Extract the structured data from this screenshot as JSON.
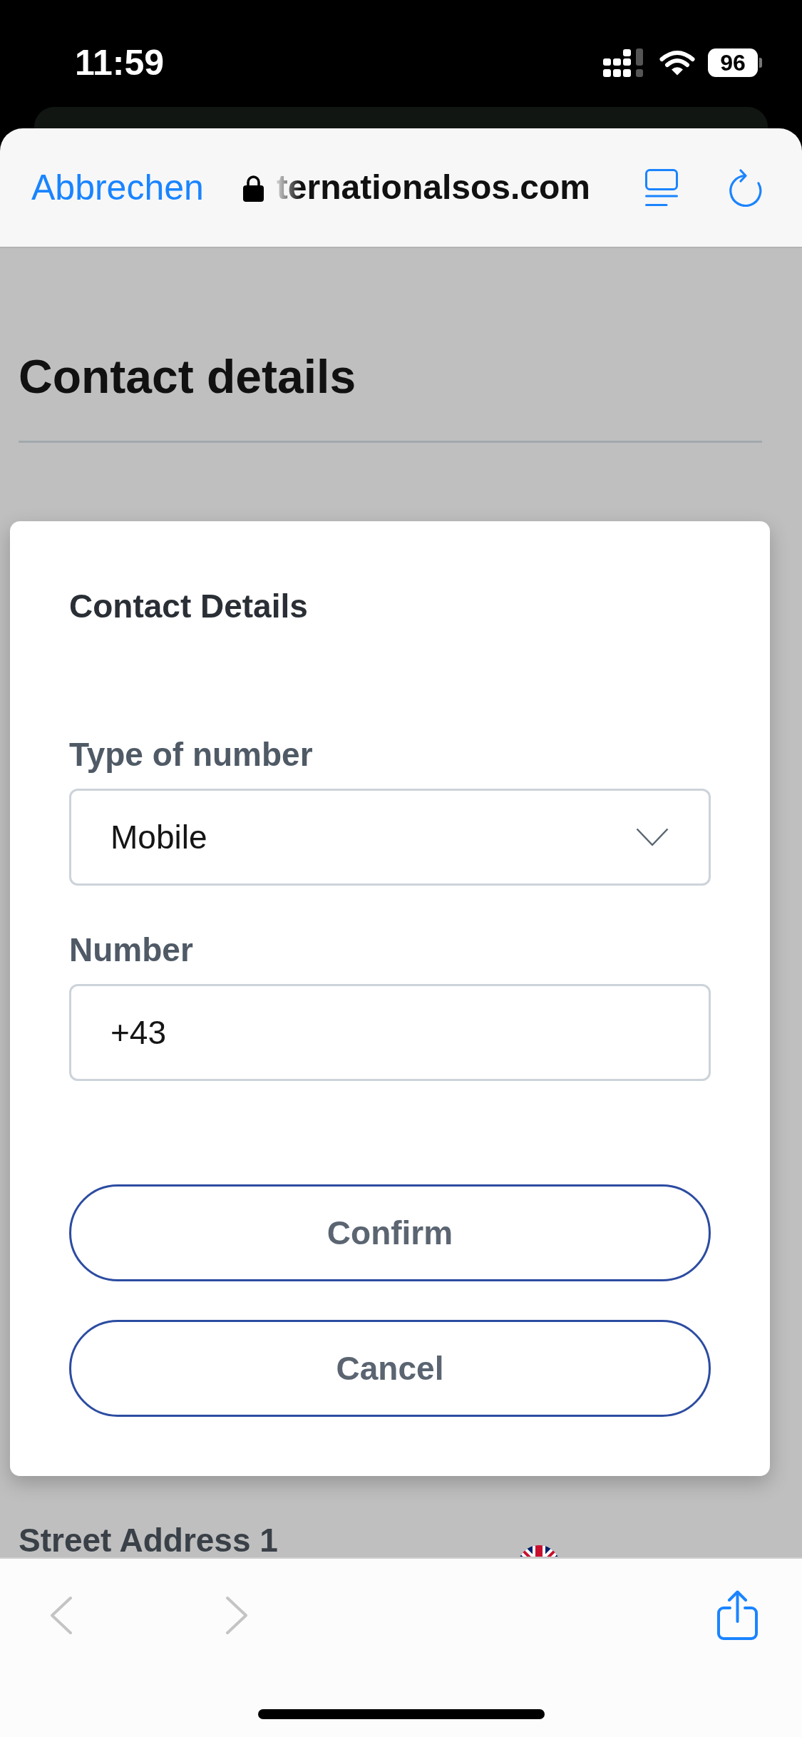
{
  "status_bar": {
    "time": "11:59",
    "battery": "96"
  },
  "browser_bar": {
    "cancel_link": "Abbrechen",
    "url": "ternationalsos.com"
  },
  "page": {
    "title": "Contact details",
    "next_label": "Street Address 1"
  },
  "dialog": {
    "title": "Contact Details",
    "fields": [
      {
        "kind": "select",
        "label": "Type of number",
        "value": "Mobile"
      },
      {
        "kind": "text",
        "label": "Number",
        "value": "+43"
      }
    ],
    "buttons": [
      {
        "label": "Confirm"
      },
      {
        "label": "Cancel"
      }
    ]
  },
  "toolbar": {
    "back": {
      "disabled": true
    },
    "forward": {
      "disabled": true
    }
  }
}
